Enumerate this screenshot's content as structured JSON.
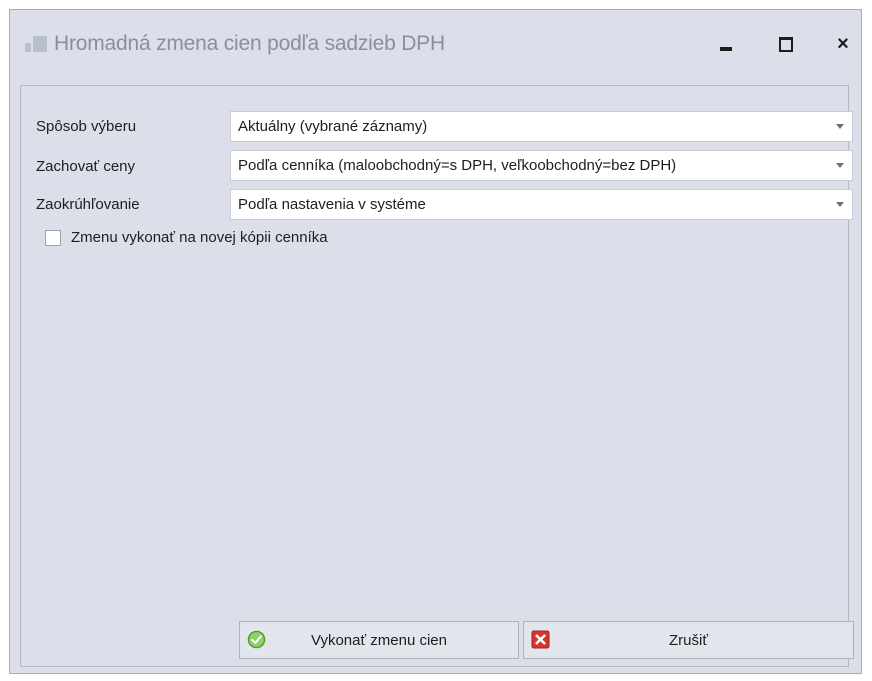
{
  "window": {
    "title": "Hromadná zmena cien podľa sadzieb DPH",
    "controls": {
      "minimize": "minimize-icon",
      "maximize": "maximize-icon",
      "close": "×"
    }
  },
  "form": {
    "fields": [
      {
        "label": "Spôsob výberu",
        "value": "Aktuálny (vybrané záznamy)"
      },
      {
        "label": "Zachovať ceny",
        "value": "Podľa cenníka (maloobchodný=s DPH, veľkoobchodný=bez DPH)"
      },
      {
        "label": "Zaokrúhľovanie",
        "value": "Podľa nastavenia v systéme"
      }
    ],
    "checkbox": {
      "label": "Zmenu vykonať na novej kópii cenníka",
      "checked": false
    }
  },
  "buttons": {
    "ok": {
      "label": "Vykonať zmenu cien",
      "icon": "check-circle-icon"
    },
    "cancel": {
      "label": "Zrušiť",
      "icon": "cancel-x-icon"
    }
  },
  "colors": {
    "window_bg": "#dcdfe9",
    "ok_icon": "#5cb83a",
    "cancel_icon": "#d9342b"
  }
}
